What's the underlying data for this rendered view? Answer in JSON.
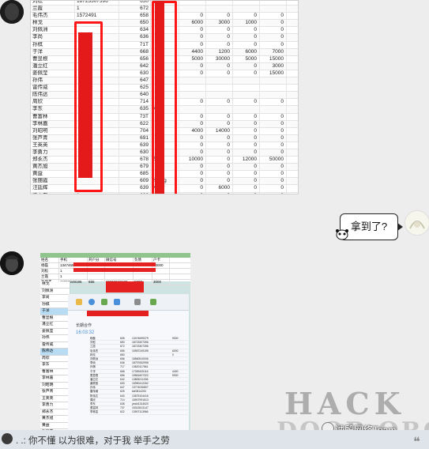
{
  "chat": {
    "sheet_rows": [
      {
        "name": "刘松",
        "phone": "18723307396",
        "n1": "650",
        "n2": "18723307",
        "a": "",
        "b": "",
        "c": "",
        "d": ""
      },
      {
        "name": "兰霞",
        "phone": "1",
        "n1": "672",
        "n2": "",
        "a": "",
        "b": "",
        "c": "",
        "d": ""
      },
      {
        "name": "毛伟杰",
        "phone": "1572491",
        "n1": "658",
        "n2": "",
        "a": "0",
        "b": "0",
        "c": "0",
        "d": "0"
      },
      {
        "name": "林戈",
        "phone": "",
        "n1": "650",
        "n2": "",
        "a": "6000",
        "b": "3000",
        "c": "1000",
        "d": "0"
      },
      {
        "name": "刘佩洲",
        "phone": "",
        "n1": "634",
        "n2": "",
        "a": "0",
        "b": "0",
        "c": "0",
        "d": "0"
      },
      {
        "name": "李尚",
        "phone": "",
        "n1": "636",
        "n2": "",
        "a": "0",
        "b": "0",
        "c": "0",
        "d": "0"
      },
      {
        "name": "孙棋",
        "phone": "",
        "n1": "71T",
        "n2": "",
        "a": "0",
        "b": "0",
        "c": "0",
        "d": "0"
      },
      {
        "name": "于洋",
        "phone": "",
        "n1": "668",
        "n2": "",
        "a": "4400",
        "b": "1200",
        "c": "6000",
        "d": "7000"
      },
      {
        "name": "曹显根",
        "phone": "",
        "n1": "656",
        "n2": "",
        "a": "5000",
        "b": "30000",
        "c": "5000",
        "d": "15000"
      },
      {
        "name": "潘立红",
        "phone": "",
        "n1": "642",
        "n2": "",
        "a": "0",
        "b": "0",
        "c": "0",
        "d": "3000"
      },
      {
        "name": "姜佩莹",
        "phone": "",
        "n1": "630",
        "n2": "",
        "a": "0",
        "b": "0",
        "c": "0",
        "d": "15000"
      },
      {
        "name": "孙伟",
        "phone": "",
        "n1": "647",
        "n2": "",
        "a": "",
        "b": "",
        "c": "",
        "d": ""
      },
      {
        "name": "雷传威",
        "phone": "",
        "n1": "625",
        "n2": "",
        "a": "",
        "b": "",
        "c": "",
        "d": ""
      },
      {
        "name": "陈伟达",
        "phone": "",
        "n1": "640",
        "n2": "",
        "a": "",
        "b": "",
        "c": "",
        "d": ""
      },
      {
        "name": "周欣",
        "phone": "",
        "n1": "714",
        "n2": "",
        "a": "0",
        "b": "0",
        "c": "0",
        "d": "0"
      },
      {
        "name": "李东",
        "phone": "",
        "n1": "635",
        "n2": "yec",
        "a": "",
        "b": "",
        "c": "",
        "d": ""
      },
      {
        "name": "曹富林",
        "phone": "",
        "n1": "73T",
        "n2": "",
        "a": "0",
        "b": "0",
        "c": "0",
        "d": "0"
      },
      {
        "name": "李林嘉",
        "phone": "",
        "n1": "622",
        "n2": "",
        "a": "0",
        "b": "0",
        "c": "0",
        "d": "0"
      },
      {
        "name": "刘昭明",
        "phone": "",
        "n1": "704",
        "n2": "",
        "a": "4000",
        "b": "14000",
        "c": "0",
        "d": "0"
      },
      {
        "name": "张芦青",
        "phone": "",
        "n1": "691",
        "n2": "",
        "a": "0",
        "b": "0",
        "c": "0",
        "d": "0"
      },
      {
        "name": "王英英",
        "phone": "",
        "n1": "639",
        "n2": "",
        "a": "0",
        "b": "0",
        "c": "0",
        "d": "0"
      },
      {
        "name": "李勇力",
        "phone": "",
        "n1": "630",
        "n2": "",
        "a": "0",
        "b": "0",
        "c": "0",
        "d": "0"
      },
      {
        "name": "郑永杰",
        "phone": "",
        "n1": "678",
        "n2": "ZLX",
        "a": "10000",
        "b": "0",
        "c": "12000",
        "d": "50000"
      },
      {
        "name": "黄杰旭",
        "phone": "",
        "n1": "679",
        "n2": "",
        "a": "0",
        "b": "0",
        "c": "0",
        "d": "0"
      },
      {
        "name": "黄益",
        "phone": "",
        "n1": "685",
        "n2": "",
        "a": "0",
        "b": "0",
        "c": "0",
        "d": "0"
      },
      {
        "name": "张丽霞",
        "phone": "",
        "n1": "609",
        "n2": "zhang",
        "a": "0",
        "b": "0",
        "c": "0",
        "d": "0"
      },
      {
        "name": "汪廷辉",
        "phone": "",
        "n1": "639",
        "n2": "wyfor",
        "a": "0",
        "b": "6000",
        "c": "0",
        "d": "0"
      },
      {
        "name": "梁小东",
        "phone": "1",
        "n1": "629",
        "n2": "188",
        "a": "0",
        "b": "0",
        "c": "0",
        "d": "0"
      }
    ],
    "my_message": "拿到了?",
    "photo": {
      "header": [
        "姓名",
        "手机",
        "开户分",
        "微信号",
        "负债",
        "户卡"
      ],
      "top_rows": [
        {
          "name": "杨磊",
          "phone": "13474699379",
          "n1": "605",
          "n2": "13474699379",
          "a": "5000",
          "b": "13000"
        },
        {
          "name": "刘松",
          "phone": "1",
          "n1": "",
          "n2": "",
          "a": "",
          "b": ""
        },
        {
          "name": "兰霞",
          "phone": "1",
          "n1": "",
          "n2": "",
          "a": "",
          "b": ""
        },
        {
          "name": "毛伟杰",
          "phone": "15957249195",
          "n1": "655",
          "n2": "15957249195",
          "a": "5000",
          "b": "3000"
        }
      ],
      "left_names": [
        "林戈",
        "刘佩洲",
        "李尚",
        "孙棋",
        "于洋",
        "曹显根",
        "潘立红",
        "姜佩莹",
        "孙伟",
        "雷传威",
        "陈伟达",
        "周欣",
        "李东",
        "曹富林",
        "李林嘉",
        "刘昭明",
        "张芦青",
        "王英英",
        "李勇力",
        "郑永杰",
        "黄杰旭",
        "黄益",
        "张丽霞",
        "汪廷辉",
        "梁小东",
        "刘野宁",
        "梁永晨"
      ],
      "panel_title": "长期合作",
      "panel_date": "16:03:32",
      "inner_rows": [
        [
          "杨磊",
          "",
          "605",
          "13474699379",
          "9000"
        ],
        [
          "刘松",
          "",
          "650",
          "18723307396",
          ""
        ],
        [
          "兰霞",
          "",
          "672",
          "18723307396",
          ""
        ],
        [
          "毛伟杰",
          "",
          "655",
          "15957249195",
          "6000"
        ],
        [
          "林戈",
          "",
          "650",
          "",
          "0"
        ],
        [
          "刘佩洲",
          "",
          "656",
          "18560510006",
          ""
        ],
        [
          "李尚",
          "",
          "636",
          "18797652998",
          ""
        ],
        [
          "孙棋",
          "",
          "717",
          "13620117561",
          ""
        ],
        [
          "于洋",
          "",
          "668",
          "17059425116",
          "4400"
        ],
        [
          "曹显根",
          "",
          "656",
          "15561607322",
          "5000"
        ],
        [
          "潘立红",
          "",
          "642",
          "13805211306",
          ""
        ],
        [
          "姜佩莹",
          "",
          "630",
          "15990412262",
          ""
        ],
        [
          "孙伟",
          "",
          "647",
          "13774030807",
          ""
        ],
        [
          "雷传威",
          "",
          "625",
          "tzlr0814200",
          ""
        ],
        [
          "陈伟达",
          "",
          "640",
          "13675104416",
          ""
        ],
        [
          "周欣",
          "",
          "714",
          "15907991513",
          ""
        ],
        [
          "李东",
          "",
          "635",
          "yeckl1314520",
          ""
        ],
        [
          "曹富林",
          "",
          "737",
          "15313513147",
          ""
        ],
        [
          "李林嘉",
          "",
          "622",
          "13907113966",
          ""
        ]
      ]
    },
    "footer_text": "你不懂 以为很难，对于我 举手之劳",
    "footer_prefix": ". .:"
  },
  "watermark": {
    "line1": "HACK",
    "line2": "DOOR.ORG",
    "brand": "诚殷网络Team"
  },
  "icons": {
    "zoom": "zoom-in-icon",
    "quote": "quote-icon"
  },
  "colors": {
    "redaction": "#e41a1a",
    "chat_bg": "#ededed",
    "footer_bg": "#dfe4ea"
  }
}
